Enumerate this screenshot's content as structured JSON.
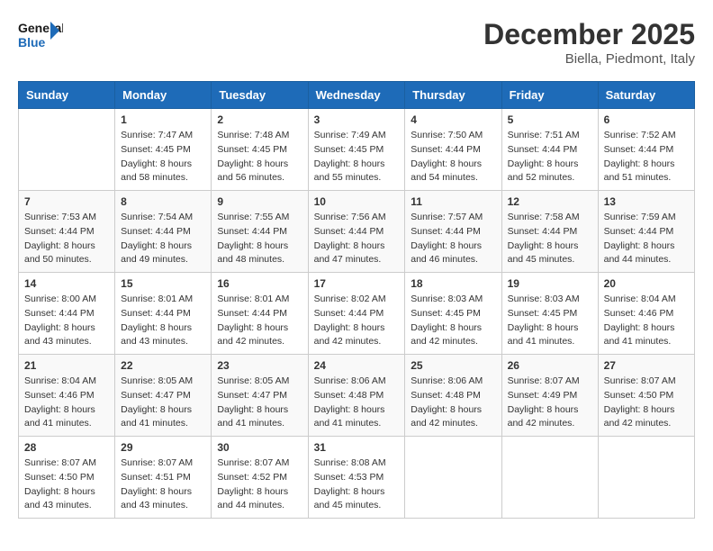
{
  "header": {
    "logo_line1": "General",
    "logo_line2": "Blue",
    "month": "December 2025",
    "location": "Biella, Piedmont, Italy"
  },
  "weekdays": [
    "Sunday",
    "Monday",
    "Tuesday",
    "Wednesday",
    "Thursday",
    "Friday",
    "Saturday"
  ],
  "weeks": [
    [
      {
        "day": "",
        "info": ""
      },
      {
        "day": "1",
        "info": "Sunrise: 7:47 AM\nSunset: 4:45 PM\nDaylight: 8 hours\nand 58 minutes."
      },
      {
        "day": "2",
        "info": "Sunrise: 7:48 AM\nSunset: 4:45 PM\nDaylight: 8 hours\nand 56 minutes."
      },
      {
        "day": "3",
        "info": "Sunrise: 7:49 AM\nSunset: 4:45 PM\nDaylight: 8 hours\nand 55 minutes."
      },
      {
        "day": "4",
        "info": "Sunrise: 7:50 AM\nSunset: 4:44 PM\nDaylight: 8 hours\nand 54 minutes."
      },
      {
        "day": "5",
        "info": "Sunrise: 7:51 AM\nSunset: 4:44 PM\nDaylight: 8 hours\nand 52 minutes."
      },
      {
        "day": "6",
        "info": "Sunrise: 7:52 AM\nSunset: 4:44 PM\nDaylight: 8 hours\nand 51 minutes."
      }
    ],
    [
      {
        "day": "7",
        "info": "Sunrise: 7:53 AM\nSunset: 4:44 PM\nDaylight: 8 hours\nand 50 minutes."
      },
      {
        "day": "8",
        "info": "Sunrise: 7:54 AM\nSunset: 4:44 PM\nDaylight: 8 hours\nand 49 minutes."
      },
      {
        "day": "9",
        "info": "Sunrise: 7:55 AM\nSunset: 4:44 PM\nDaylight: 8 hours\nand 48 minutes."
      },
      {
        "day": "10",
        "info": "Sunrise: 7:56 AM\nSunset: 4:44 PM\nDaylight: 8 hours\nand 47 minutes."
      },
      {
        "day": "11",
        "info": "Sunrise: 7:57 AM\nSunset: 4:44 PM\nDaylight: 8 hours\nand 46 minutes."
      },
      {
        "day": "12",
        "info": "Sunrise: 7:58 AM\nSunset: 4:44 PM\nDaylight: 8 hours\nand 45 minutes."
      },
      {
        "day": "13",
        "info": "Sunrise: 7:59 AM\nSunset: 4:44 PM\nDaylight: 8 hours\nand 44 minutes."
      }
    ],
    [
      {
        "day": "14",
        "info": "Sunrise: 8:00 AM\nSunset: 4:44 PM\nDaylight: 8 hours\nand 43 minutes."
      },
      {
        "day": "15",
        "info": "Sunrise: 8:01 AM\nSunset: 4:44 PM\nDaylight: 8 hours\nand 43 minutes."
      },
      {
        "day": "16",
        "info": "Sunrise: 8:01 AM\nSunset: 4:44 PM\nDaylight: 8 hours\nand 42 minutes."
      },
      {
        "day": "17",
        "info": "Sunrise: 8:02 AM\nSunset: 4:44 PM\nDaylight: 8 hours\nand 42 minutes."
      },
      {
        "day": "18",
        "info": "Sunrise: 8:03 AM\nSunset: 4:45 PM\nDaylight: 8 hours\nand 42 minutes."
      },
      {
        "day": "19",
        "info": "Sunrise: 8:03 AM\nSunset: 4:45 PM\nDaylight: 8 hours\nand 41 minutes."
      },
      {
        "day": "20",
        "info": "Sunrise: 8:04 AM\nSunset: 4:46 PM\nDaylight: 8 hours\nand 41 minutes."
      }
    ],
    [
      {
        "day": "21",
        "info": "Sunrise: 8:04 AM\nSunset: 4:46 PM\nDaylight: 8 hours\nand 41 minutes."
      },
      {
        "day": "22",
        "info": "Sunrise: 8:05 AM\nSunset: 4:47 PM\nDaylight: 8 hours\nand 41 minutes."
      },
      {
        "day": "23",
        "info": "Sunrise: 8:05 AM\nSunset: 4:47 PM\nDaylight: 8 hours\nand 41 minutes."
      },
      {
        "day": "24",
        "info": "Sunrise: 8:06 AM\nSunset: 4:48 PM\nDaylight: 8 hours\nand 41 minutes."
      },
      {
        "day": "25",
        "info": "Sunrise: 8:06 AM\nSunset: 4:48 PM\nDaylight: 8 hours\nand 42 minutes."
      },
      {
        "day": "26",
        "info": "Sunrise: 8:07 AM\nSunset: 4:49 PM\nDaylight: 8 hours\nand 42 minutes."
      },
      {
        "day": "27",
        "info": "Sunrise: 8:07 AM\nSunset: 4:50 PM\nDaylight: 8 hours\nand 42 minutes."
      }
    ],
    [
      {
        "day": "28",
        "info": "Sunrise: 8:07 AM\nSunset: 4:50 PM\nDaylight: 8 hours\nand 43 minutes."
      },
      {
        "day": "29",
        "info": "Sunrise: 8:07 AM\nSunset: 4:51 PM\nDaylight: 8 hours\nand 43 minutes."
      },
      {
        "day": "30",
        "info": "Sunrise: 8:07 AM\nSunset: 4:52 PM\nDaylight: 8 hours\nand 44 minutes."
      },
      {
        "day": "31",
        "info": "Sunrise: 8:08 AM\nSunset: 4:53 PM\nDaylight: 8 hours\nand 45 minutes."
      },
      {
        "day": "",
        "info": ""
      },
      {
        "day": "",
        "info": ""
      },
      {
        "day": "",
        "info": ""
      }
    ]
  ]
}
